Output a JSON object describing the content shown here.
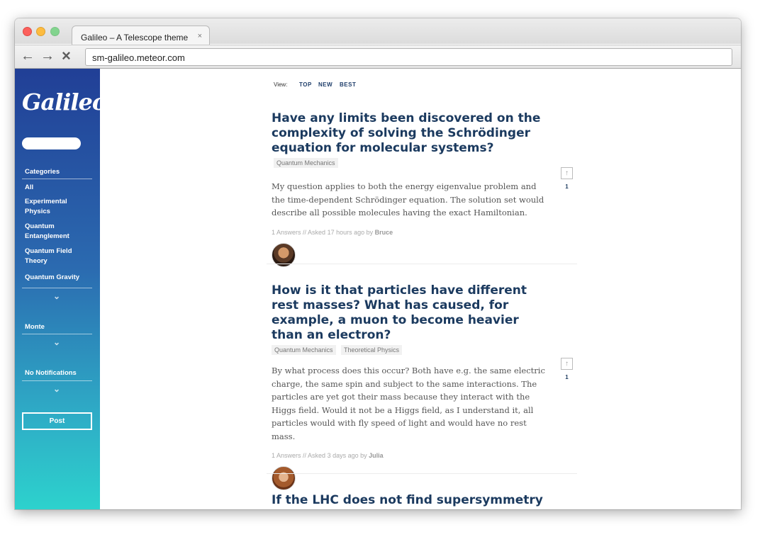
{
  "browser": {
    "tab_title": "Galileo – A Telescope theme",
    "tab_close": "×",
    "url": "sm-galileo.meteor.com",
    "icons": {
      "back": "back-arrow-icon",
      "forward": "forward-arrow-icon",
      "stop": "stop-icon"
    }
  },
  "sidebar": {
    "logo": "Galileo",
    "categories_title": "Categories",
    "categories": [
      {
        "label": "All"
      },
      {
        "label": "Experimental Physics"
      },
      {
        "label": "Quantum Entanglement"
      },
      {
        "label": "Quantum Field Theory"
      },
      {
        "label": "Quantum Gravity"
      }
    ],
    "user_title": "Monte",
    "notifications_title": "No Notifications",
    "post_label": "Post",
    "colors": {
      "top": "#213f96",
      "bottom": "#2dd2cd"
    }
  },
  "view": {
    "label": "View:",
    "options": [
      "TOP",
      "NEW",
      "BEST"
    ]
  },
  "posts": [
    {
      "title": "Have any limits been discovered on the complexity of solving the Schrödinger equation for molecular systems?",
      "tags": [
        "Quantum Mechanics"
      ],
      "body": "My question applies to both the energy eigenvalue problem and the time-dependent Schrödinger equation. The solution set would describe all possible molecules having the exact Hamiltonian.",
      "answers": "1 Answers",
      "asked": "// Asked 17 hours ago by",
      "author": "Bruce",
      "votes": "1",
      "upvote_icon": "↑"
    },
    {
      "title": "How is it that particles have different rest masses? What has caused, for example, a muon to become heavier than an electron?",
      "tags": [
        "Quantum Mechanics",
        "Theoretical Physics"
      ],
      "body": "By what process does this occur? Both have e.g. the same electric charge, the same spin and subject to the same interactions. The particles are yet got their mass because they interact with the Higgs field. Would it not be a Higgs field, as I understand it, all particles would with fly speed of light and would have no rest mass.",
      "answers": "1 Answers",
      "asked": "// Asked 3 days ago by",
      "author": "Julia",
      "votes": "1",
      "upvote_icon": "↑"
    },
    {
      "title": "If the LHC does not find supersymmetry by"
    }
  ]
}
